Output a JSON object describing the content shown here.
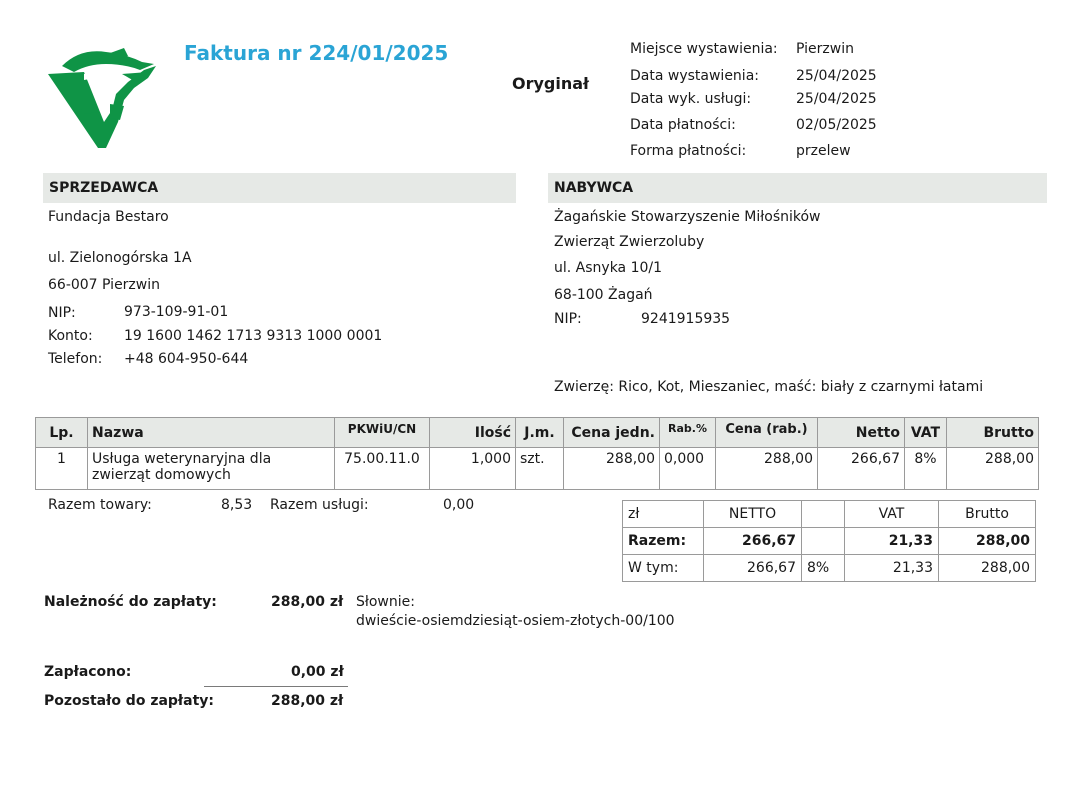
{
  "logo": {
    "icon": "green-bird-v-logo",
    "color": "#0f9446"
  },
  "invoice": {
    "title": "Faktura nr 224/01/2025",
    "copy": "Oryginał"
  },
  "meta": {
    "issue_place_label": "Miejsce wystawienia:",
    "issue_place": "Pierzwin",
    "issue_date_label": "Data wystawienia:",
    "issue_date": "25/04/2025",
    "service_date_label": "Data wyk. usługi:",
    "service_date": "25/04/2025",
    "payment_date_label": "Data płatności:",
    "payment_date": "02/05/2025",
    "payment_form_label": "Forma płatności:",
    "payment_form": "przelew"
  },
  "seller": {
    "header": "SPRZEDAWCA",
    "name": "Fundacja Bestaro",
    "street": "ul. Zielonogórska 1A",
    "city": "66-007 Pierzwin",
    "nip_label": "NIP:",
    "nip": "973-109-91-01",
    "account_label": "Konto:",
    "account": "19 1600 1462 1713 9313 1000 0001",
    "phone_label": "Telefon:",
    "phone": "+48 604-950-644"
  },
  "buyer": {
    "header": "NABYWCA",
    "name_line1": "Żagańskie Stowarzyszenie Miłośników",
    "name_line2": "Zwierząt Zwierzoluby",
    "street": "ul. Asnyka 10/1",
    "city": "68-100 Żagań",
    "nip_label": "NIP:",
    "nip": "9241915935"
  },
  "animal_note": "Zwierzę: Rico, Kot, Mieszaniec, maść: biały z czarnymi łatami",
  "items": {
    "headers": {
      "lp": "Lp.",
      "name": "Nazwa",
      "pkwiu": "PKWiU/CN",
      "qty": "Ilość",
      "unit": "J.m.",
      "unit_price": "Cena jedn.",
      "discount": "Rab.%",
      "price_disc": "Cena (rab.)",
      "net": "Netto",
      "vat": "VAT",
      "gross": "Brutto"
    },
    "rows": [
      {
        "lp": "1",
        "name_line1": "Usługa weterynaryjna dla",
        "name_line2": "zwierząt domowych",
        "pkwiu": "75.00.11.0",
        "qty": "1,000",
        "unit": "szt.",
        "unit_price": "288,00",
        "discount": "0,000",
        "price_disc": "288,00",
        "net": "266,67",
        "vat": "8%",
        "gross": "288,00"
      }
    ]
  },
  "totals_goods": {
    "goods_label": "Razem towary:",
    "goods": "8,53",
    "services_label": "Razem usługi:",
    "services": "0,00"
  },
  "summary": {
    "h_currency": "zł",
    "h_net": "NETTO",
    "h_vat": "VAT",
    "h_gross": "Brutto",
    "total_label": "Razem:",
    "total_net": "266,67",
    "total_vat": "21,33",
    "total_gross": "288,00",
    "incl_label": "W tym:",
    "incl_net": "266,67",
    "incl_rate": "8%",
    "incl_vat": "21,33",
    "incl_gross": "288,00"
  },
  "due": {
    "label": "Należność do zapłaty:",
    "amount": "288,00 zł",
    "words_label": "Słownie:",
    "words": "dwieście-osiemdziesiąt-osiem-złotych-00/100"
  },
  "paid": {
    "label": "Zapłacono:",
    "amount": "0,00 zł"
  },
  "remaining": {
    "label": "Pozostało do zapłaty:",
    "amount": "288,00 zł"
  }
}
